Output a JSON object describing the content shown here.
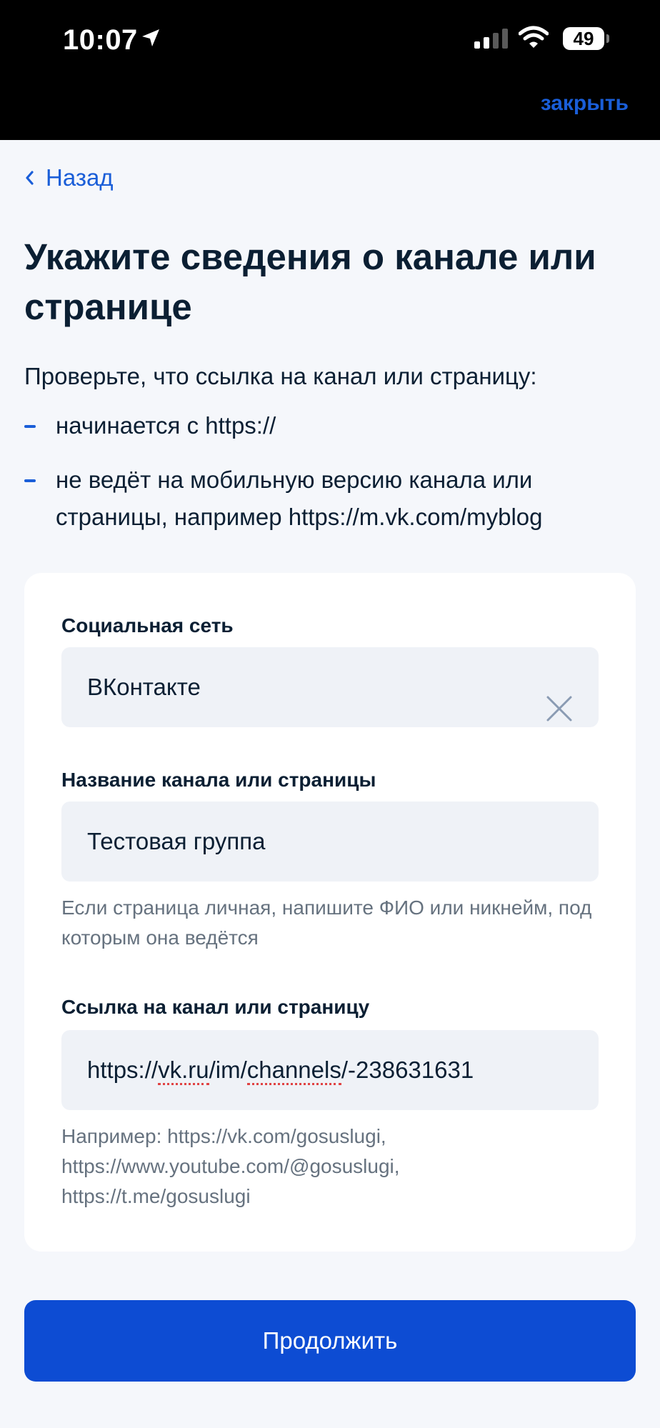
{
  "status_bar": {
    "time": "10:07",
    "battery": "49"
  },
  "header": {
    "close_label": "закрыть"
  },
  "nav": {
    "back_label": "Назад"
  },
  "page": {
    "title": "Укажите сведения о канале или странице",
    "intro": "Проверьте, что ссылка на канал или страницу:",
    "bullets": [
      "начинается с https://",
      "не ведёт на мобильную версию канала или страницы, например https://m.vk.com/myblog"
    ]
  },
  "form": {
    "social": {
      "label": "Социальная сеть",
      "value": "ВКонтакте"
    },
    "name": {
      "label": "Название канала или страницы",
      "value": "Тестовая группа",
      "hint": "Если страница личная, напишите ФИО или никнейм, под которым она ведётся"
    },
    "link": {
      "label": "Ссылка на канал или страницу",
      "value_prefix": "https://",
      "value_word1": "vk.ru",
      "value_mid": "/im/",
      "value_word2": "channels",
      "value_suffix": "/-238631631",
      "hint_lines": [
        "Например: https://vk.com/gosuslugi,",
        "https://www.youtube.com/@gosuslugi,",
        "https://t.me/gosuslugi"
      ]
    }
  },
  "actions": {
    "continue_label": "Продолжить"
  },
  "colors": {
    "accent": "#1a5ed8",
    "primary_button": "#0d4cd3",
    "background": "#f5f7fb",
    "field": "#eff2f7"
  }
}
